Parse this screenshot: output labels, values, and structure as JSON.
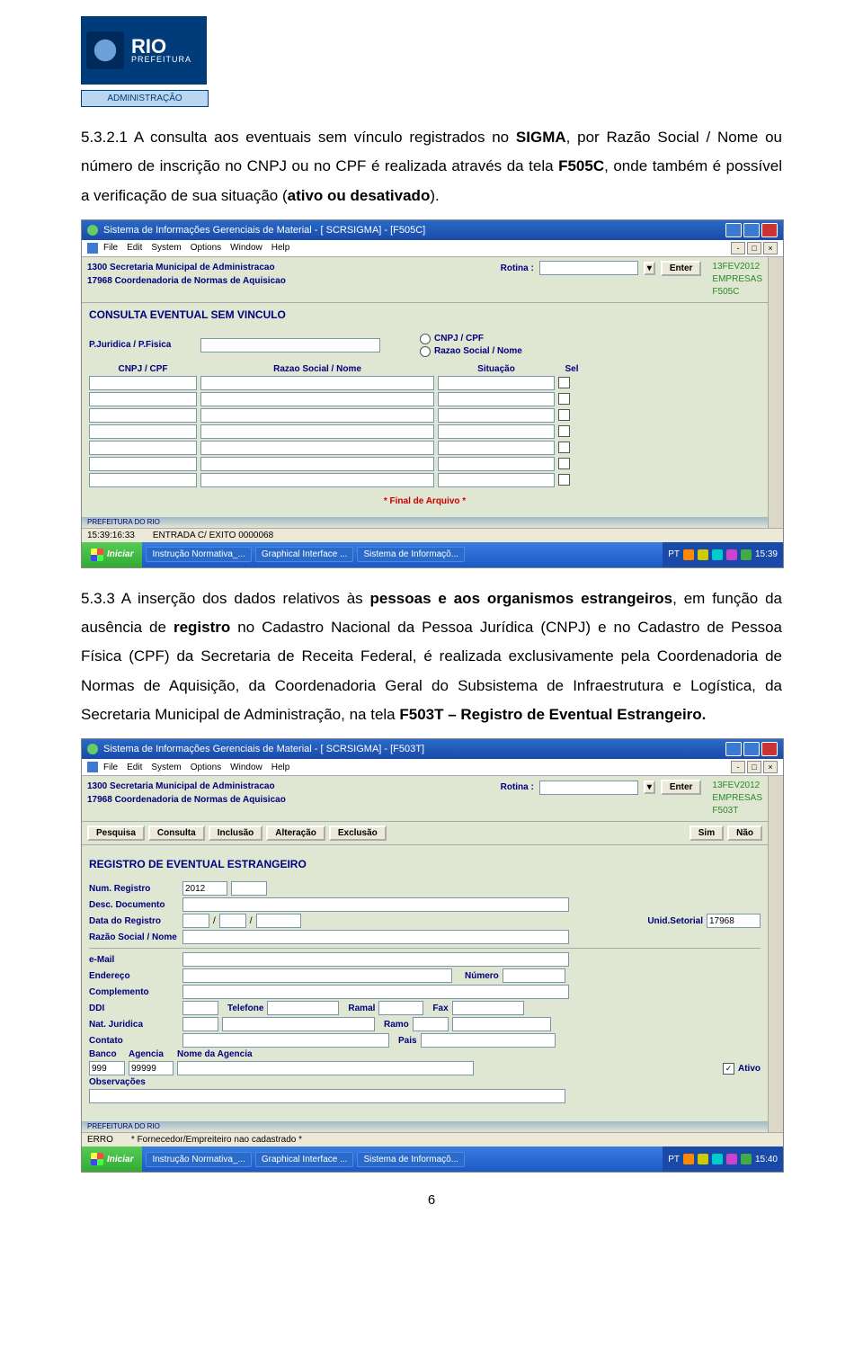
{
  "logo": {
    "brand": "RIO",
    "sub": "PREFEITURA",
    "dept": "ADMINISTRAÇÃO"
  },
  "para1": {
    "t1": "5.3.2.1 A consulta aos eventuais sem vínculo registrados no ",
    "b1": "SIGMA",
    "t2": ", por Razão Social / Nome ou número de inscrição no CNPJ ou no CPF é realizada através da tela ",
    "b2": "F505C",
    "t3": ", onde também é possível a verificação de sua situação (",
    "b3": "ativo ou desativado",
    "t4": ")."
  },
  "shot1": {
    "title": "Sistema de Informações Gerenciais de Material - [ SCRSIGMA] - [F505C]",
    "menu": [
      "File",
      "Edit",
      "System",
      "Options",
      "Window",
      "Help"
    ],
    "hdr1": "1300 Secretaria Municipal de Administracao",
    "hdr2": "17968 Coordenadoria de Normas de Aquisicao",
    "rotina": "Rotina :",
    "enter": "Enter",
    "date": "13FEV2012",
    "tag": "EMPRESAS",
    "code": "F505C",
    "bigtitle": "CONSULTA EVENTUAL SEM VINCULO",
    "pj": "P.Juridica / P.Fisica",
    "rad1": "CNPJ / CPF",
    "rad2": "Razao Social / Nome",
    "col1": "CNPJ / CPF",
    "col2": "Razao Social / Nome",
    "col3": "Situação",
    "col4": "Sel",
    "final": "* Final de Arquivo *",
    "prefrio": "PREFEITURA DO RIO",
    "status_time": "15:39:16:33",
    "status_msg": "ENTRADA C/ EXITO   0000068",
    "start": "Iniciar",
    "tasks": [
      "Instrução Normativa_...",
      "Graphical Interface ...",
      "Sistema de Informaçõ..."
    ],
    "lang": "PT",
    "clock": "15:39"
  },
  "para2": {
    "t1": "5.3.3 A inserção dos dados relativos às ",
    "b1": "pessoas e aos organismos estrangeiros",
    "t2": ", em função da ausência de ",
    "b2": "registro",
    "t3": " no Cadastro Nacional da Pessoa Jurídica (CNPJ) e no Cadastro de Pessoa Física (CPF) da Secretaria de Receita Federal, é realizada exclusivamente pela Coordenadoria de Normas de Aquisição, da Coordenadoria Geral do Subsistema de Infraestrutura e Logística, da Secretaria Municipal de Administração, na tela ",
    "b3": "F503T – Registro de Eventual Estrangeiro."
  },
  "shot2": {
    "title": "Sistema de Informações Gerenciais de Material - [ SCRSIGMA] - [F503T]",
    "menu": [
      "File",
      "Edit",
      "System",
      "Options",
      "Window",
      "Help"
    ],
    "hdr1": "1300 Secretaria Municipal de Administracao",
    "hdr2": "17968 Coordenadoria de Normas de Aquisicao",
    "rotina": "Rotina :",
    "enter": "Enter",
    "date": "13FEV2012",
    "tag": "EMPRESAS",
    "code": "F503T",
    "tabs": [
      "Pesquisa",
      "Consulta",
      "Inclusão",
      "Alteração",
      "Exclusão"
    ],
    "sim": "Sim",
    "nao": "Não",
    "bigtitle": "REGISTRO DE EVENTUAL ESTRANGEIRO",
    "f": {
      "num": "Num. Registro",
      "num_v": "2012",
      "desc": "Desc. Documento",
      "data": "Data do Registro",
      "unid": "Unid.Setorial",
      "unid_v": "17968",
      "razao": "Razão Social / Nome",
      "email": "e-Mail",
      "end": "Endereço",
      "numero": "Número",
      "comp": "Complemento",
      "ddi": "DDI",
      "tel": "Telefone",
      "ramal": "Ramal",
      "fax": "Fax",
      "nat": "Nat. Juridica",
      "ramo": "Ramo",
      "contato": "Contato",
      "pais": "Pais",
      "banco": "Banco",
      "banco_v": "999",
      "ag": "Agencia",
      "ag_v": "99999",
      "nomeag": "Nome da Agencia",
      "ativo": "Ativo",
      "obs": "Observações"
    },
    "prefrio": "PREFEITURA DO RIO",
    "status_l": "ERRO",
    "status_r": "* Fornecedor/Empreiteiro nao cadastrado *",
    "start": "Iniciar",
    "tasks": [
      "Instrução Normativa_...",
      "Graphical Interface ...",
      "Sistema de Informaçõ..."
    ],
    "lang": "PT",
    "clock": "15:40"
  },
  "pagenum": "6"
}
